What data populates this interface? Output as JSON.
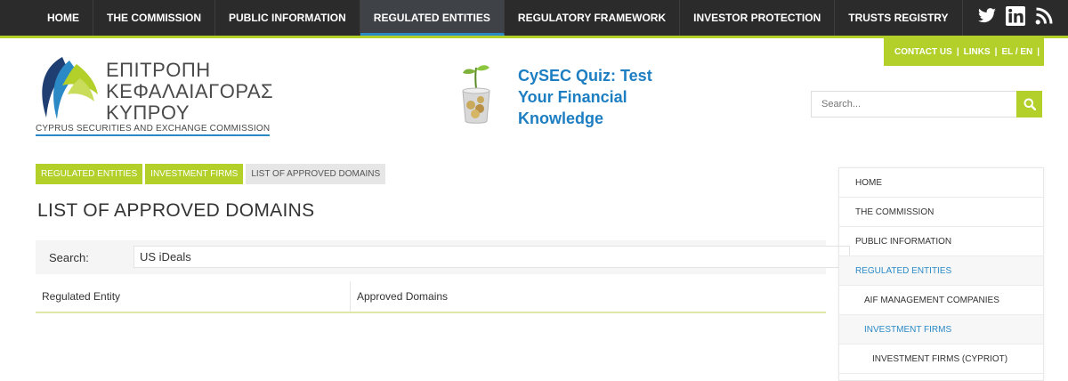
{
  "nav": {
    "items": [
      {
        "label": "HOME"
      },
      {
        "label": "THE COMMISSION"
      },
      {
        "label": "PUBLIC INFORMATION"
      },
      {
        "label": "REGULATED ENTITIES"
      },
      {
        "label": "REGULATORY FRAMEWORK"
      },
      {
        "label": "INVESTOR PROTECTION"
      },
      {
        "label": "TRUSTS REGISTRY"
      }
    ],
    "active_index": 3,
    "social": [
      "twitter-icon",
      "linkedin-icon",
      "rss-icon"
    ]
  },
  "contact_bar": {
    "contact": "CONTACT US",
    "links": "LINKS",
    "lang": "EL / EN",
    "sep": "|"
  },
  "logo": {
    "greek_line1": "ΕΠΙΤΡΟΠΗ",
    "greek_line2": "ΚΕΦΑΛΑΙΑΓΟΡΑΣ",
    "greek_line3": "ΚΥΠΡΟΥ",
    "english": "CYPRUS SECURITIES AND EXCHANGE COMMISSION"
  },
  "quiz": {
    "line1": "CySEC Quiz: Test",
    "line2": "Your Financial",
    "line3": "Knowledge"
  },
  "header_search": {
    "placeholder": "Search..."
  },
  "breadcrumb": [
    {
      "label": "REGULATED ENTITIES"
    },
    {
      "label": "INVESTMENT FIRMS"
    },
    {
      "label": "LIST OF APPROVED DOMAINS"
    }
  ],
  "page_title": "LIST OF APPROVED DOMAINS",
  "table_search": {
    "label": "Search:",
    "value": "US iDeals"
  },
  "table": {
    "columns": [
      "Regulated Entity",
      "Approved Domains"
    ]
  },
  "sidebar": {
    "items": [
      {
        "label": "HOME"
      },
      {
        "label": "THE COMMISSION"
      },
      {
        "label": "PUBLIC INFORMATION"
      },
      {
        "label": "REGULATED ENTITIES"
      },
      {
        "label": "AIF MANAGEMENT COMPANIES"
      },
      {
        "label": "INVESTMENT FIRMS"
      },
      {
        "label": "INVESTMENT FIRMS (CYPRIOT)"
      }
    ]
  },
  "colors": {
    "accent_green": "#b2cf2a",
    "accent_blue": "#2b8ac6",
    "nav_bg": "#2b2b2b"
  }
}
